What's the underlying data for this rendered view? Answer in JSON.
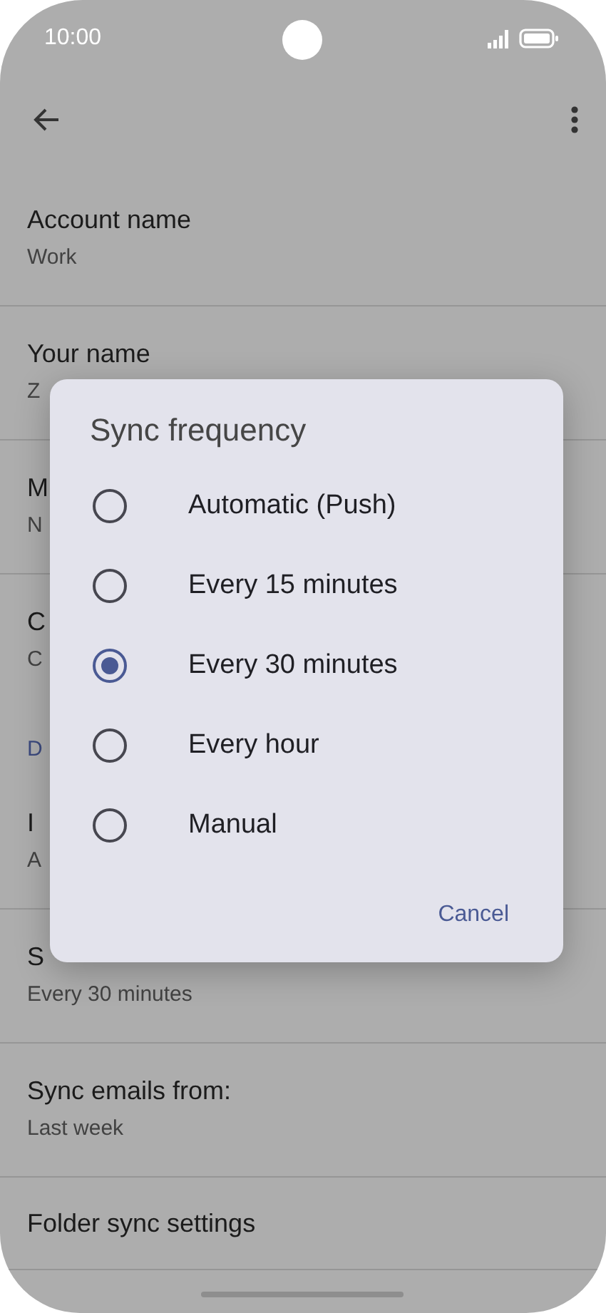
{
  "status_bar": {
    "time": "10:00"
  },
  "settings": [
    {
      "kind": "row",
      "title": "Account name",
      "value": "Work"
    },
    {
      "kind": "row",
      "title": "Your name",
      "value": "Z"
    },
    {
      "kind": "row",
      "title": "M",
      "value": "N"
    },
    {
      "kind": "row",
      "title": "C",
      "value": "C"
    },
    {
      "kind": "header",
      "title": "D"
    },
    {
      "kind": "row",
      "title": "I",
      "value": "A"
    },
    {
      "kind": "row",
      "title": "S",
      "value": "Every 30 minutes"
    },
    {
      "kind": "row",
      "title": "Sync emails from:",
      "value": "Last week"
    },
    {
      "kind": "row",
      "title": "Folder sync settings"
    }
  ],
  "dialog": {
    "title": "Sync frequency",
    "options": [
      {
        "label": "Automatic (Push)",
        "selected": false
      },
      {
        "label": "Every 15 minutes",
        "selected": false
      },
      {
        "label": "Every 30 minutes",
        "selected": true
      },
      {
        "label": "Every hour",
        "selected": false
      },
      {
        "label": "Manual",
        "selected": false
      }
    ],
    "buttons": [
      "Cancel"
    ]
  }
}
